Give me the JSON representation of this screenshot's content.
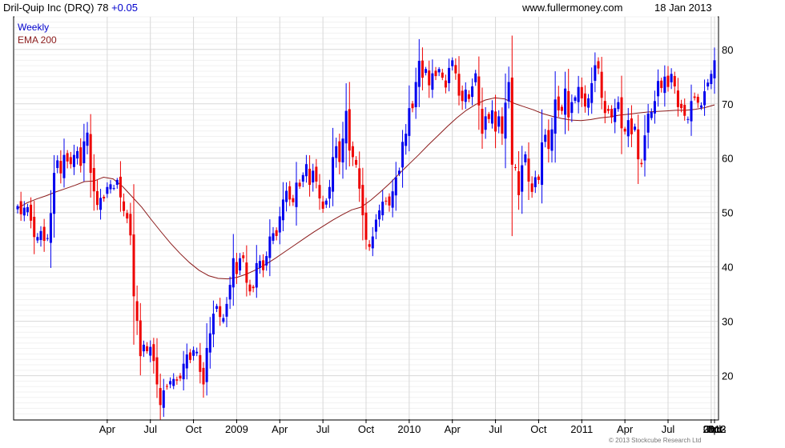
{
  "header": {
    "title": "Dril-Quip Inc (DRQ) 78",
    "change": "+0.05",
    "site": "www.fullermoney.com",
    "date": "18 Jan 2013"
  },
  "legend": {
    "series1": "Weekly",
    "series2": "EMA 200"
  },
  "copyright": "© 2013 Stockcube Research Ltd",
  "colors": {
    "up": "#0000ee",
    "down": "#ee0000",
    "ema": "#8b1a1a",
    "grid": "#d8d8d8"
  },
  "chart_data": {
    "type": "candlestick",
    "ylim": [
      12,
      86
    ],
    "yticks": [
      20,
      30,
      40,
      50,
      60,
      70,
      80
    ],
    "xticks": [
      "Apr",
      "Jul",
      "Oct",
      "2009",
      "Apr",
      "Jul",
      "Oct",
      "2010",
      "Apr",
      "Jul",
      "Oct",
      "2011",
      "Apr",
      "Jul",
      "Oct",
      "2012",
      "Apr",
      "Jul",
      "Oct",
      "2013"
    ],
    "grid": true,
    "legend_position": "top-left",
    "close_weekly": [
      51.2,
      49.7,
      50.9,
      51.0,
      48.5,
      45.5,
      45.5,
      46.6,
      44.8,
      45.3,
      49.9,
      57.3,
      59.6,
      57.2,
      60.6,
      59.4,
      58.9,
      60.6,
      61.3,
      58.6,
      63.1,
      64.7,
      57.3,
      53.9,
      51.4,
      52.7,
      52.6,
      54.7,
      55.2,
      54.5,
      56.0,
      52.8,
      50.3,
      48.9,
      45.8,
      34.6,
      30.1,
      23.6,
      25.7,
      24.5,
      25.3,
      22.7,
      18.4,
      14.6,
      17.3,
      18.1,
      19.0,
      19.4,
      19.1,
      19.5,
      22.2,
      23.9,
      22.9,
      24.7,
      24.4,
      20.7,
      18.4,
      25.1,
      27.8,
      31.4,
      32.8,
      30.8,
      30.6,
      33.2,
      36.7,
      41.6,
      38.7,
      41.6,
      41.6,
      37.1,
      35.5,
      36.1,
      40.7,
      41.1,
      39.4,
      42.0,
      45.6,
      46.2,
      45.7,
      49.3,
      52.4,
      54.0,
      52.4,
      51.9,
      55.5,
      54.8,
      56.9,
      58.9,
      55.1,
      57.7,
      55.7,
      52.6,
      50.7,
      52.2,
      54.7,
      60.2,
      62.2,
      59.3,
      63.6,
      68.7,
      61.4,
      60.2,
      58.8,
      54.4,
      49.5,
      45.0,
      43.7,
      45.6,
      48.7,
      50.4,
      52.0,
      52.1,
      51.3,
      53.9,
      56.5,
      57.7,
      63.0,
      64.5,
      69.2,
      69.2,
      74.0,
      77.9,
      74.8,
      76.4,
      73.4,
      75.6,
      75.1,
      76.4,
      74.8,
      73.0,
      76.6,
      78.0,
      75.6,
      71.5,
      70.5,
      72.6,
      70.9,
      73.2,
      75.6,
      69.7,
      64.5,
      67.7,
      67.2,
      68.8,
      64.9,
      67.7,
      64.5,
      70.2,
      74.0,
      58.8,
      58.3,
      53.2,
      58.7,
      60.7,
      55.7,
      53.8,
      56.5,
      56.0,
      62.9,
      64.3,
      61.7,
      65.3,
      70.8,
      68.8,
      68.7,
      72.8,
      67.5,
      70.3,
      71.2,
      73.1,
      71.0,
      69.5,
      71.0,
      73.8,
      77.1,
      76.5,
      71.1,
      68.3,
      68.7,
      67.5,
      69.2,
      70.3,
      65.5,
      64.9,
      67.0,
      64.4,
      65.8,
      59.8,
      58.9,
      64.2,
      68.2,
      68.5,
      70.5,
      74.2,
      72.9,
      75.0,
      73.1,
      75.5,
      73.2,
      69.4,
      69.2,
      67.8,
      67.2,
      70.5,
      71.1,
      70.2,
      69.7,
      72.3,
      73.9,
      75.5,
      78.0
    ],
    "ema200": [
      50.8,
      51.8,
      52.5,
      53.1,
      53.8,
      54.4,
      55.0,
      55.7,
      55.8,
      56.5,
      56.2,
      54.8,
      52.9,
      51.0,
      48.7,
      46.5,
      44.4,
      42.5,
      40.8,
      39.4,
      38.4,
      37.9,
      37.8,
      38.1,
      38.7,
      39.5,
      40.5,
      41.6,
      42.8,
      44.0,
      45.2,
      46.4,
      47.5,
      48.6,
      49.6,
      50.5,
      51.0,
      52.3,
      53.8,
      55.4,
      57.2,
      58.9,
      60.6,
      62.4,
      64.1,
      65.8,
      67.4,
      68.8,
      69.9,
      70.7,
      71.1,
      70.9,
      70.1,
      69.5,
      68.9,
      68.2,
      67.7,
      67.3,
      67.0,
      66.9,
      67.1,
      67.4,
      67.6,
      67.9,
      68.1,
      68.3,
      68.5,
      68.6,
      68.7,
      68.8,
      68.8,
      69.0,
      69.3,
      69.8
    ]
  }
}
